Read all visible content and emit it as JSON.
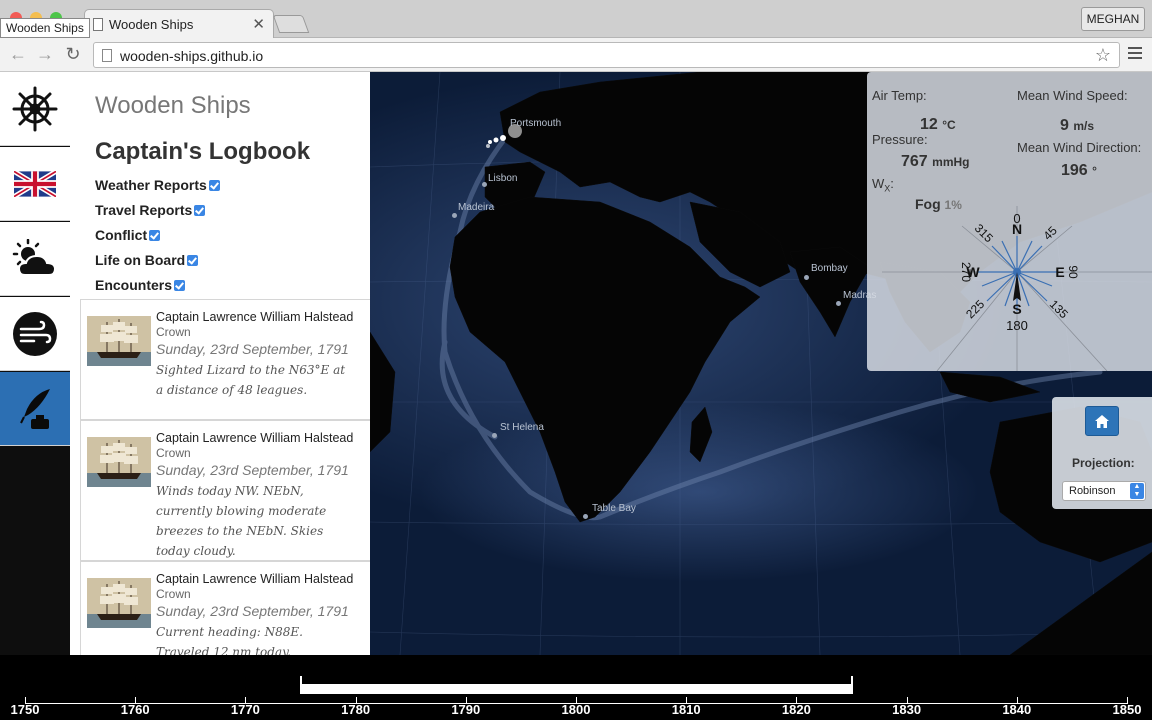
{
  "browser": {
    "tooltip_title": "Wooden Ships",
    "tab_title": "Wooden Ships",
    "url": "wooden-ships.github.io",
    "user": "MEGHAN"
  },
  "sidebar": {
    "icons": [
      "ships-wheel-icon",
      "union-jack-flag-icon",
      "weather-icon",
      "wind-icon",
      "quill-inkwell-icon"
    ],
    "active_index": 4
  },
  "panel": {
    "brand": "Wooden Ships",
    "title": "Captain's Logbook",
    "filters": [
      "Weather Reports",
      "Travel Reports",
      "Conflict",
      "Life on Board",
      "Encounters"
    ],
    "entries": [
      {
        "captain": "Captain Lawrence William Halstead",
        "vessel": "Crown",
        "date": "Sunday, 23rd September, 1791",
        "note": "Sighted Lizard to the N63°E at a distance of 48 leagues."
      },
      {
        "captain": "Captain Lawrence William Halstead",
        "vessel": "Crown",
        "date": "Sunday, 23rd September, 1791",
        "note": "Winds today NW. NEbN, currently blowing moderate breezes to the NEbN. Skies today cloudy."
      },
      {
        "captain": "Captain Lawrence William Halstead",
        "vessel": "Crown",
        "date": "Sunday, 23rd September, 1791",
        "note": "Current heading: N88E. Traveled 12 nm today."
      }
    ]
  },
  "map": {
    "places": [
      "Portsmouth",
      "Lisbon",
      "Madeira",
      "Bombay",
      "Madras",
      "St Helena",
      "Table Bay"
    ]
  },
  "weather": {
    "air_temp_label": "Air Temp:",
    "air_temp_value": "12",
    "air_temp_unit": "°C",
    "pressure_label": "Pressure:",
    "pressure_value": "767",
    "pressure_unit": "mmHg",
    "wx_label": "W",
    "wx_sub": "X",
    "wx_value": "Fog",
    "wx_pct": "1%",
    "wind_speed_label": "Mean Wind Speed:",
    "wind_speed_value": "9",
    "wind_speed_unit": "m/s",
    "wind_dir_label": "Mean Wind Direction:",
    "wind_dir_value": "196",
    "wind_dir_unit": "°",
    "compass": {
      "N": "N",
      "S": "S",
      "E": "E",
      "W": "W",
      "deg_0": "0",
      "deg_45": "45",
      "deg_90": "90",
      "deg_135": "135",
      "deg_180": "180",
      "deg_225": "225",
      "deg_270": "270",
      "deg_315": "315"
    }
  },
  "projection": {
    "label": "Projection:",
    "selected": "Robinson"
  },
  "timeline": {
    "years": [
      "1750",
      "1760",
      "1770",
      "1780",
      "1790",
      "1800",
      "1810",
      "1820",
      "1830",
      "1840",
      "1850"
    ],
    "brush_start_year": 1775,
    "brush_end_year": 1825
  }
}
